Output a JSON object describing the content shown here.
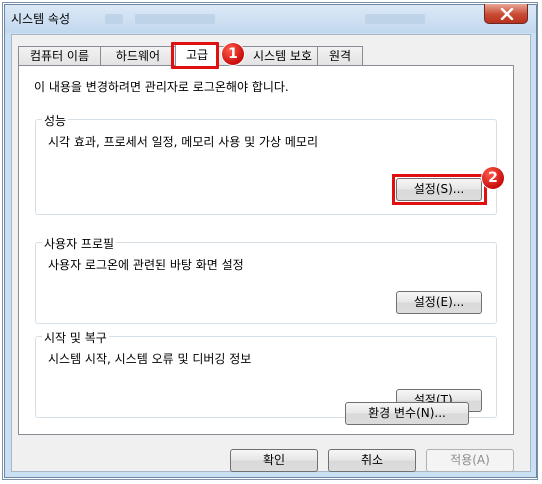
{
  "window": {
    "title": "시스템 속성"
  },
  "tabs": [
    {
      "label": "컴퓨터 이름"
    },
    {
      "label": "하드웨어"
    },
    {
      "label": "고급"
    },
    {
      "label": "시스템 보호"
    },
    {
      "label": "원격"
    }
  ],
  "active_tab": "고급",
  "notice": "이 내용을 변경하려면 관리자로 로그온해야 합니다.",
  "sections": {
    "performance": {
      "title": "성능",
      "description": "시각 효과, 프로세서 일정, 메모리 사용 및 가상 메모리",
      "button": "설정(S)..."
    },
    "user_profiles": {
      "title": "사용자 프로필",
      "description": "사용자 로그온에 관련된 바탕 화면 설정",
      "button": "설정(E)..."
    },
    "startup_recovery": {
      "title": "시작 및 복구",
      "description": "시스템 시작, 시스템 오류 및 디버깅 정보",
      "button": "설정(T)..."
    }
  },
  "env_button": "환경 변수(N)...",
  "footer": {
    "ok": "확인",
    "cancel": "취소",
    "apply": "적용(A)"
  },
  "annotations": {
    "marker1": "1",
    "marker2": "2",
    "highlight_color": "#e01010"
  },
  "icons": {
    "close": "close-x-icon"
  }
}
